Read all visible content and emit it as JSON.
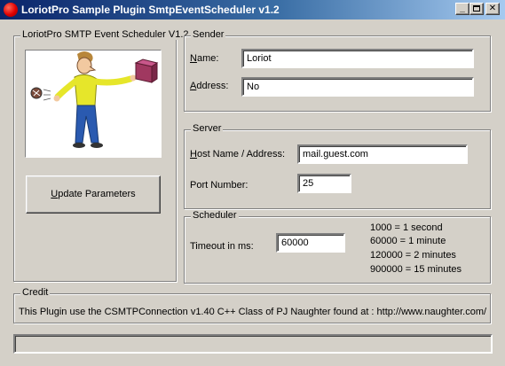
{
  "window": {
    "title": "LoriotPro Sample Plugin SmtpEventScheduler v1.2",
    "minimize": "_",
    "close": "✕"
  },
  "left_panel": {
    "title": "LoriotPro SMTP Event Scheduler V1.2",
    "update_button_u": "U",
    "update_button_rest": "pdate Parameters"
  },
  "sender": {
    "title": "Sender",
    "name_label_u": "N",
    "name_label_rest": "ame:",
    "name_value": "Loriot",
    "address_label_u": "A",
    "address_label_rest": "ddress:",
    "address_value": "No"
  },
  "server": {
    "title": "Server",
    "host_label_u": "H",
    "host_label_rest": "ost Name / Address:",
    "host_value": "mail.guest.com",
    "port_label": "Port Number:",
    "port_value": "25"
  },
  "scheduler": {
    "title": "Scheduler",
    "timeout_label": "Timeout in ms:",
    "timeout_value": "60000",
    "legend": [
      "1000 = 1 second",
      "60000 = 1 minute",
      "120000 = 2 minutes",
      "900000 = 15 minutes"
    ]
  },
  "credit": {
    "title": "Credit",
    "text": "This Plugin use the CSMTPConnection v1.40 C++ Class of PJ Naughter found at :  http://www.naughter.com/"
  },
  "status_bar": {
    "text": ""
  },
  "colors": {
    "face": "#d4d0c8",
    "title_start": "#0a246a",
    "title_end": "#a6caf0",
    "icon_red": "#e00000"
  }
}
